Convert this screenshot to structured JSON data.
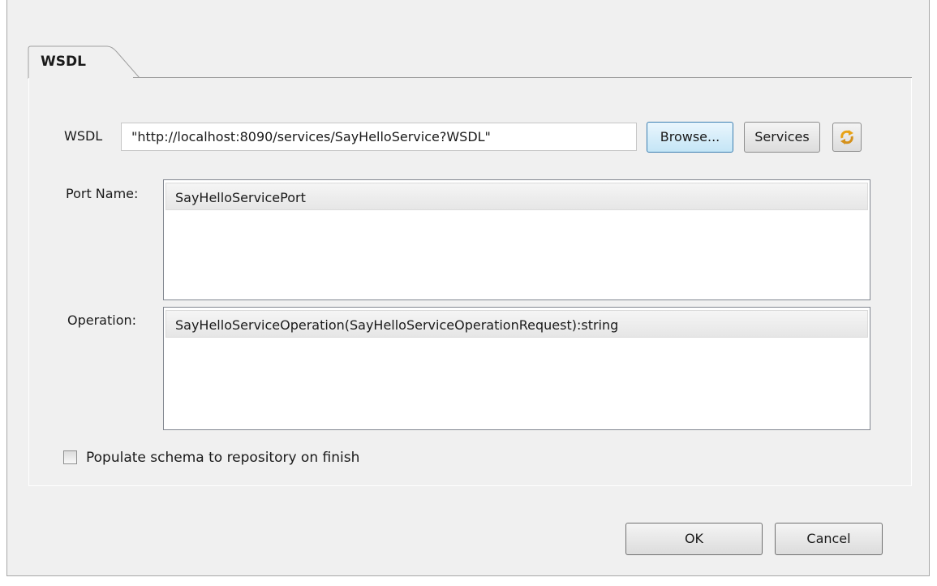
{
  "tab": {
    "label": "WSDL"
  },
  "wsdl": {
    "label": "WSDL",
    "value": "\"http://localhost:8090/services/SayHelloService?WSDL\"",
    "browse_label": "Browse...",
    "services_label": "Services",
    "refresh_icon": "refresh-arrows-icon"
  },
  "port": {
    "label": "Port Name:",
    "items": [
      "SayHelloServicePort"
    ]
  },
  "operation": {
    "label": "Operation:",
    "items": [
      "SayHelloServiceOperation(SayHelloServiceOperationRequest):string"
    ]
  },
  "populate": {
    "label": "Populate schema to repository on finish",
    "checked": false
  },
  "buttons": {
    "ok_label": "OK",
    "cancel_label": "Cancel"
  }
}
